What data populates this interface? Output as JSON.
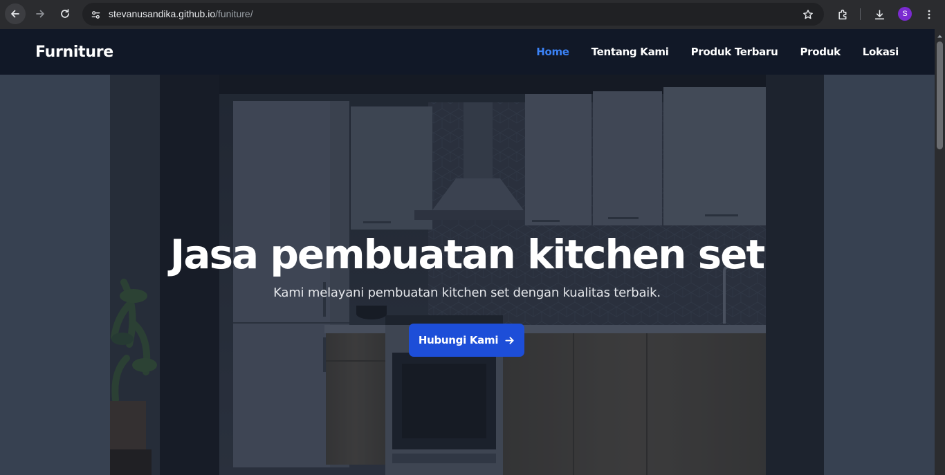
{
  "browser": {
    "url_host": "stevanusandika.github.io",
    "url_path": "/funiture/",
    "profile_initial": "S",
    "icons": {
      "back": "arrow-left-icon",
      "forward": "arrow-right-icon",
      "reload": "reload-icon",
      "site_info": "tune-icon",
      "bookmark": "star-icon",
      "extensions": "puzzle-icon",
      "downloads": "download-icon",
      "menu": "kebab-menu-icon"
    },
    "profile_color": "#7b2bd0"
  },
  "site": {
    "brand": "Furniture",
    "nav": [
      {
        "label": "Home",
        "active": true
      },
      {
        "label": "Tentang Kami",
        "active": false
      },
      {
        "label": "Produk Terbaru",
        "active": false
      },
      {
        "label": "Produk",
        "active": false
      },
      {
        "label": "Lokasi",
        "active": false
      }
    ],
    "colors": {
      "header_bg": "#111827",
      "page_bg": "#374151",
      "active_link": "#3b82f6",
      "cta_bg": "#1d4ed8"
    }
  },
  "hero": {
    "title": "Jasa pembuatan kitchen set",
    "subtitle": "Kami melayani pembuatan kitchen set dengan kualitas terbaik.",
    "cta_label": "Hubungi Kami",
    "cta_icon": "arrow-right-icon",
    "background_image": "kitchen-set-photo"
  }
}
